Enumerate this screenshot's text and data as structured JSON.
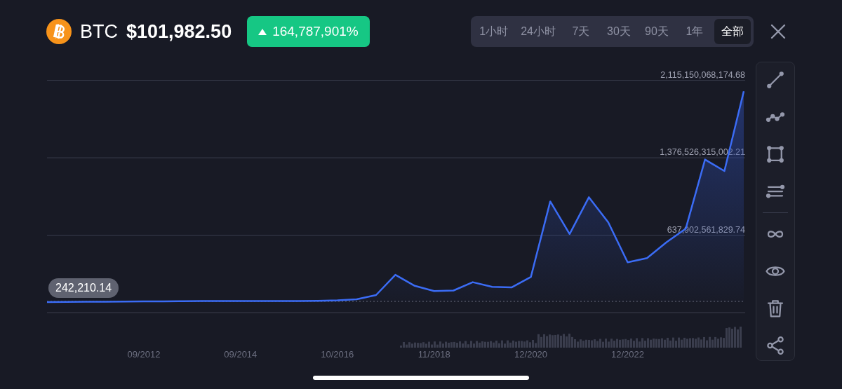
{
  "header": {
    "symbol": "BTC",
    "price": "$101,982.50",
    "change": {
      "text": "164,787,901%",
      "rising": true
    }
  },
  "timeframes": [
    {
      "label": "1小时",
      "selected": false
    },
    {
      "label": "24小时",
      "selected": false
    },
    {
      "label": "7天",
      "selected": false
    },
    {
      "label": "30天",
      "selected": false
    },
    {
      "label": "90天",
      "selected": false
    },
    {
      "label": "1年",
      "selected": false
    },
    {
      "label": "全部",
      "selected": true
    }
  ],
  "chart": {
    "current_value_label": "242,210.14",
    "chart_data": {
      "type": "area",
      "categories": [
        null,
        null,
        null,
        null,
        null,
        "09/2012",
        null,
        null,
        null,
        null,
        "09/2014",
        null,
        null,
        null,
        null,
        "10/2016",
        null,
        null,
        null,
        null,
        "11/2018",
        null,
        null,
        null,
        null,
        "12/2020",
        null,
        null,
        null,
        null,
        "12/2022",
        null,
        null,
        null,
        null,
        null,
        null
      ],
      "series": [
        {
          "color": "#3b6cf5",
          "values": [
            1000000000.0,
            2000000000.0,
            3000000000.0,
            4000000000.0,
            5000000000.0,
            6000000000.0,
            7000000000.0,
            8000000000.0,
            10000000000.0,
            10000000000.0,
            10000000000.0,
            10000000000.0,
            10000000000.0,
            10000000000.0,
            12000000000.0,
            17000000000.0,
            27000000000.0,
            67000000000.0,
            260000000000.0,
            155000000000.0,
            105000000000.0,
            110000000000.0,
            190000000000.0,
            145000000000.0,
            140000000000.0,
            240000000000.0,
            960000000000.0,
            650000000000.0,
            1000000000000.0,
            760000000000.0,
            380000000000.0,
            420000000000.0,
            570000000000.0,
            700000000000.0,
            1360000000000.0,
            1250000000000.0,
            2010000000000.0
          ]
        }
      ],
      "ylim": [
        0,
        2115150068174.68
      ],
      "grid": true,
      "yticks": [
        {
          "value": 637902561829.74,
          "label": "637,902,561,829.74"
        },
        {
          "value": 1376526315002.21,
          "label": "1,376,526,315,002.21"
        },
        {
          "value": 2115150068174.68,
          "label": "2,115,150,068,174.68"
        }
      ]
    }
  }
}
